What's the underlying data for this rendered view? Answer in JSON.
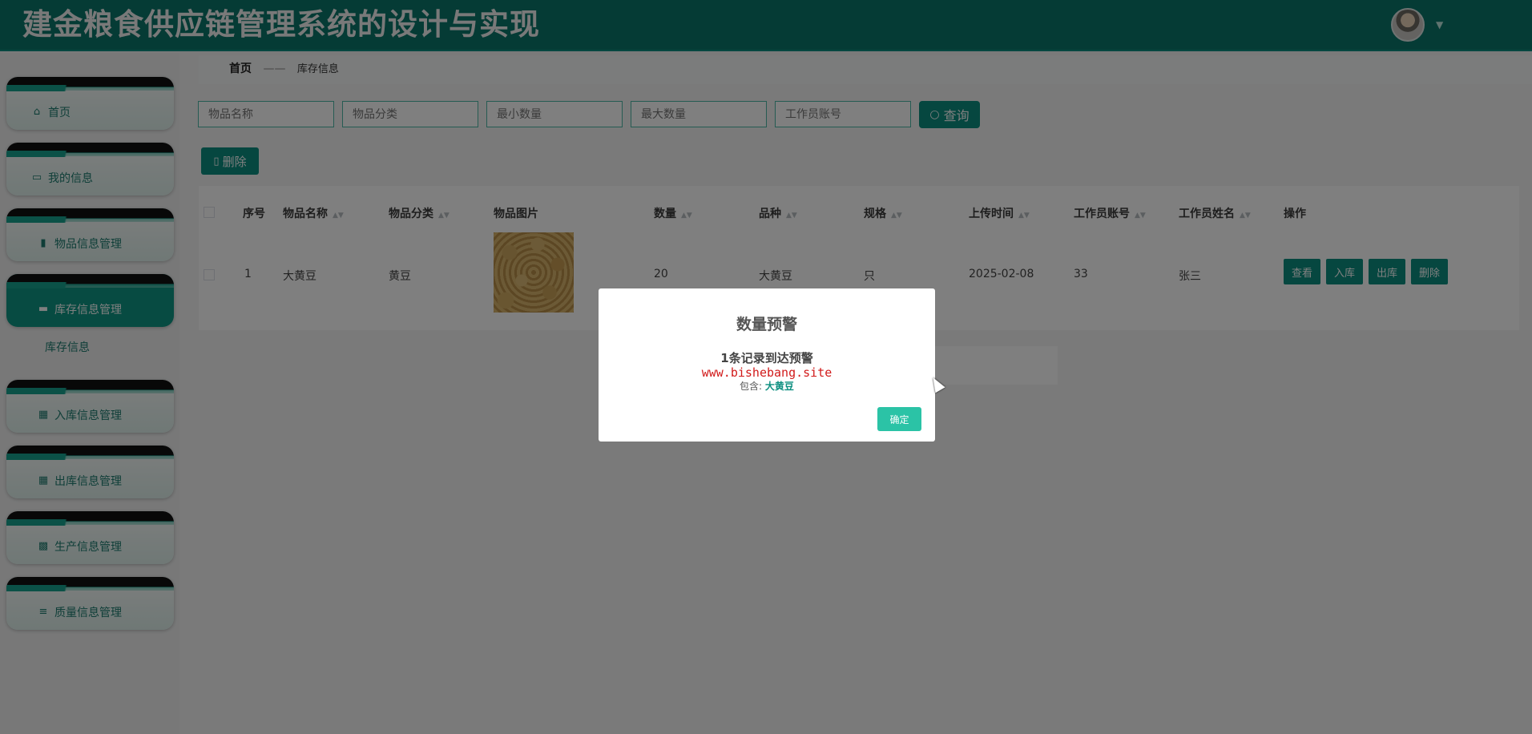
{
  "header": {
    "title": "建金粮食供应链管理系统的设计与实现"
  },
  "sidebar": {
    "items": [
      {
        "label": "首页",
        "icon": "home-icon"
      },
      {
        "label": "我的信息",
        "icon": "id-card-icon"
      },
      {
        "label": "物品信息管理",
        "icon": "clipboard-icon"
      },
      {
        "label": "库存信息管理",
        "icon": "briefcase-icon"
      },
      {
        "label": "入库信息管理",
        "icon": "grid-icon"
      },
      {
        "label": "出库信息管理",
        "icon": "grid-icon"
      },
      {
        "label": "生产信息管理",
        "icon": "table-icon"
      },
      {
        "label": "质量信息管理",
        "icon": "sliders-icon"
      }
    ],
    "submenu": "库存信息"
  },
  "breadcrumb": {
    "home": "首页",
    "separator": "——",
    "current": "库存信息"
  },
  "search": {
    "placeholders": [
      "物品名称",
      "物品分类",
      "最小数量",
      "最大数量",
      "工作员账号"
    ],
    "button": "查询"
  },
  "toolbar": {
    "delete_label": "删除"
  },
  "table": {
    "headers": [
      "序号",
      "物品名称",
      "物品分类",
      "物品图片",
      "数量",
      "品种",
      "规格",
      "上传时间",
      "工作员账号",
      "工作员姓名",
      "操作"
    ],
    "rows": [
      {
        "index": "1",
        "name": "大黄豆",
        "category": "黄豆",
        "quantity": "20",
        "variety": "大黄豆",
        "spec": "只",
        "upload_time": "2025-02-08",
        "account": "33",
        "staff_name": "张三"
      }
    ],
    "actions": [
      "查看",
      "入库",
      "出库",
      "删除"
    ]
  },
  "dialog": {
    "title": "数量预警",
    "message": "1条记录到达预警",
    "watermark": "www.bishebang.site",
    "contains_label": "包含:",
    "contains_value": "大黄豆",
    "ok_label": "确定"
  },
  "colors": {
    "primary": "#0d8f80",
    "header_bg": "#0a766a",
    "ok_button": "#2bc3a6",
    "watermark": "#d11a1a"
  }
}
